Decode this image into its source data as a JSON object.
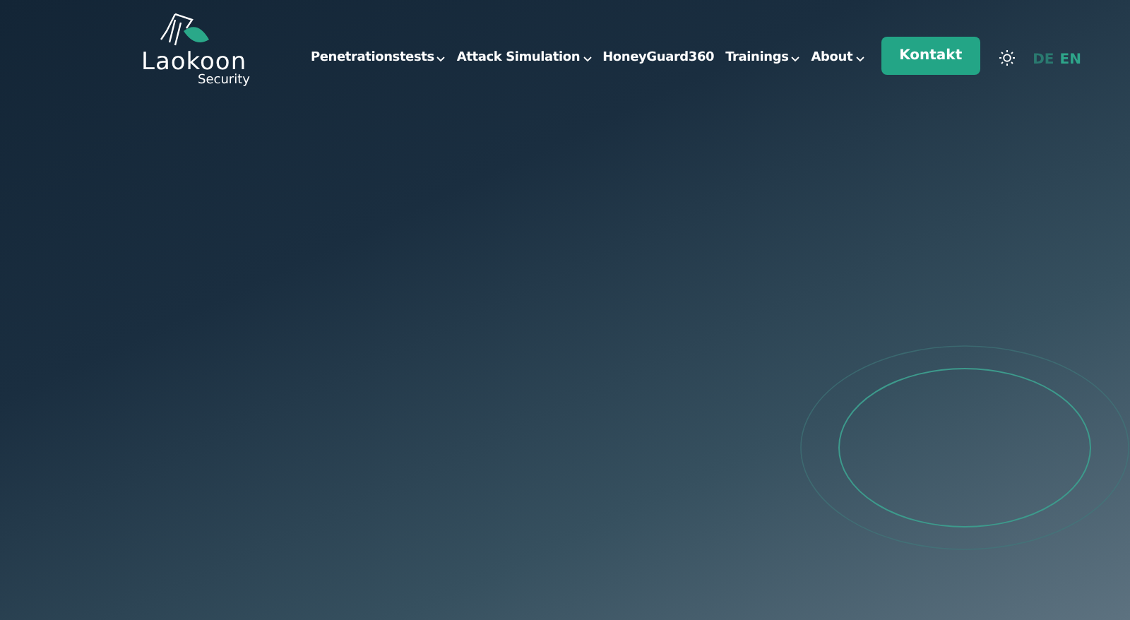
{
  "logo": {
    "name": "Laokoon",
    "tagline": "Security"
  },
  "nav": [
    {
      "label": "Penetrationstests",
      "dropdown": true
    },
    {
      "label": "Attack Simulation",
      "dropdown": true
    },
    {
      "label": "HoneyGuard360",
      "dropdown": false
    },
    {
      "label": "Trainings",
      "dropdown": true
    },
    {
      "label": "About",
      "dropdown": true
    }
  ],
  "cta": "Kontakt",
  "languages": [
    {
      "label": "DE",
      "selected": false
    },
    {
      "label": "EN",
      "selected": true
    }
  ]
}
